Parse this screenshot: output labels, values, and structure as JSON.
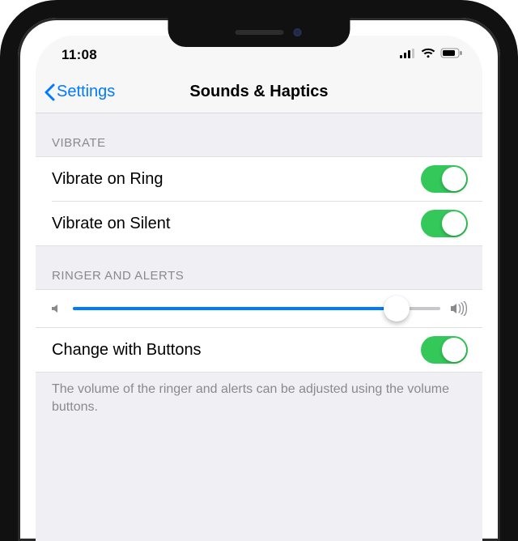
{
  "status": {
    "time": "11:08"
  },
  "nav": {
    "back_label": "Settings",
    "title": "Sounds & Haptics"
  },
  "sections": {
    "vibrate": {
      "header": "VIBRATE",
      "vibrate_on_ring": {
        "label": "Vibrate on Ring",
        "value": true
      },
      "vibrate_on_silent": {
        "label": "Vibrate on Silent",
        "value": true
      }
    },
    "ringer": {
      "header": "RINGER AND ALERTS",
      "volume_percent": 88,
      "change_with_buttons": {
        "label": "Change with Buttons",
        "value": true
      },
      "footer": "The volume of the ringer and alerts can be adjusted using the volume buttons."
    }
  },
  "colors": {
    "tint": "#007aff",
    "toggle_on": "#34c759",
    "group_bg": "#efeff4",
    "secondary_text": "#8a8a8e"
  }
}
